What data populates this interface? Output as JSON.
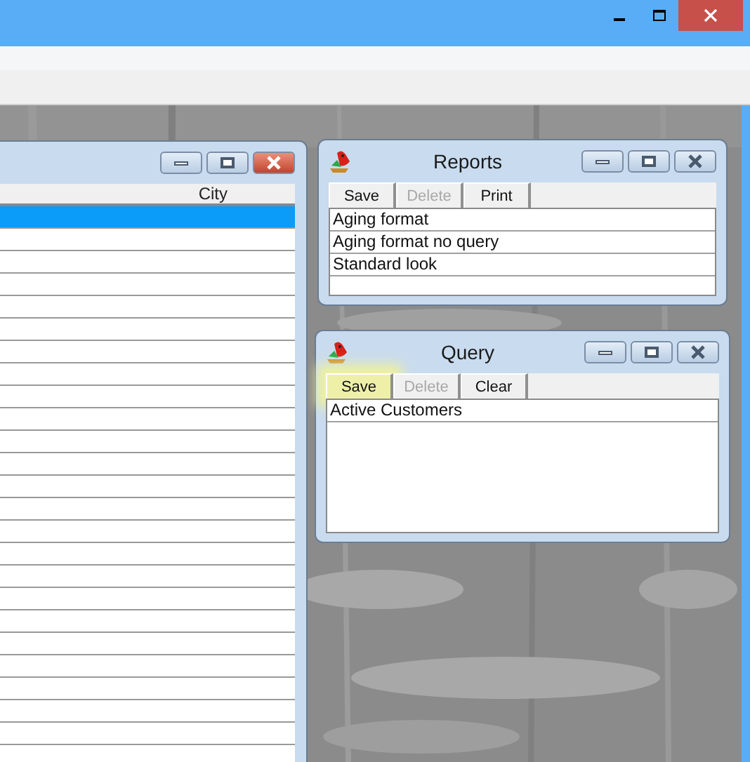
{
  "grid_window": {
    "columns": [
      {
        "label": "City"
      }
    ],
    "rows": [
      {
        "selected": true
      },
      {
        "selected": false
      },
      {
        "selected": false
      },
      {
        "selected": false
      },
      {
        "selected": false
      },
      {
        "selected": false
      },
      {
        "selected": false
      },
      {
        "selected": false
      },
      {
        "selected": false
      },
      {
        "selected": false
      },
      {
        "selected": false
      },
      {
        "selected": false
      },
      {
        "selected": false
      },
      {
        "selected": false
      },
      {
        "selected": false
      },
      {
        "selected": false
      },
      {
        "selected": false
      },
      {
        "selected": false
      },
      {
        "selected": false
      },
      {
        "selected": false
      },
      {
        "selected": false
      },
      {
        "selected": false
      },
      {
        "selected": false
      },
      {
        "selected": false
      }
    ]
  },
  "reports_window": {
    "title": "Reports",
    "buttons": [
      {
        "label": "Save",
        "disabled": false,
        "highlighted": false
      },
      {
        "label": "Delete",
        "disabled": true,
        "highlighted": false
      },
      {
        "label": "Print",
        "disabled": false,
        "highlighted": false
      }
    ],
    "items": [
      "Aging format",
      "Aging format no query",
      "Standard look"
    ]
  },
  "query_window": {
    "title": "Query",
    "buttons": [
      {
        "label": "Save",
        "disabled": false,
        "highlighted": true
      },
      {
        "label": "Delete",
        "disabled": true,
        "highlighted": false
      },
      {
        "label": "Clear",
        "disabled": false,
        "highlighted": false
      }
    ],
    "items": [
      "Active Customers"
    ]
  }
}
